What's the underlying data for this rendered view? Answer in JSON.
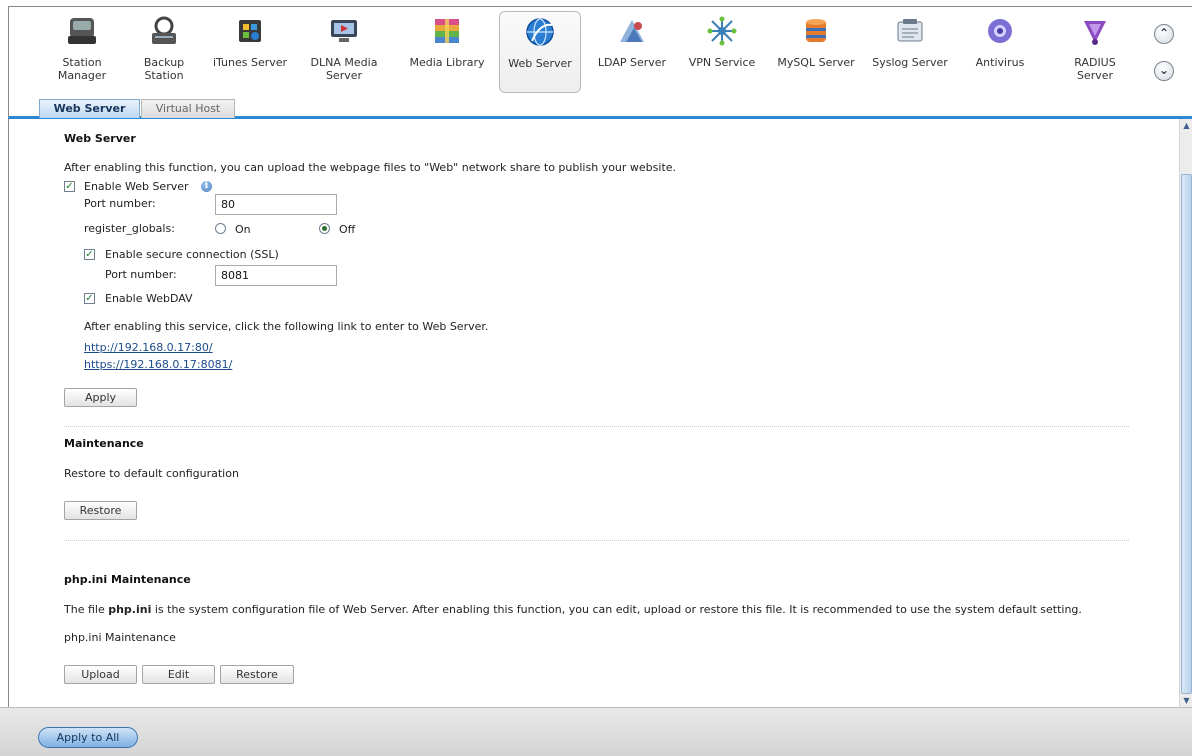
{
  "apps": [
    {
      "id": "station-manager",
      "label": "Station\nManager",
      "icon": "station-manager-icon"
    },
    {
      "id": "backup-station",
      "label": "Backup\nStation",
      "icon": "backup-station-icon"
    },
    {
      "id": "itunes-server",
      "label": "iTunes Server",
      "icon": "itunes-server-icon"
    },
    {
      "id": "dlna-media-server",
      "label": "DLNA Media\nServer",
      "icon": "dlna-media-server-icon"
    },
    {
      "id": "media-library",
      "label": "Media Library",
      "icon": "media-library-icon"
    },
    {
      "id": "web-server",
      "label": "Web Server",
      "icon": "web-server-icon",
      "active": true
    },
    {
      "id": "ldap-server",
      "label": "LDAP Server",
      "icon": "ldap-server-icon"
    },
    {
      "id": "vpn-service",
      "label": "VPN Service",
      "icon": "vpn-service-icon"
    },
    {
      "id": "mysql-server",
      "label": "MySQL Server",
      "icon": "mysql-server-icon"
    },
    {
      "id": "syslog-server",
      "label": "Syslog Server",
      "icon": "syslog-server-icon"
    },
    {
      "id": "antivirus",
      "label": "Antivirus",
      "icon": "antivirus-icon"
    },
    {
      "id": "radius-server",
      "label": "RADIUS\nServer",
      "icon": "radius-server-icon"
    }
  ],
  "nav": {
    "up_icon": "chevron-up-icon",
    "down_icon": "chevron-down-icon"
  },
  "tabs": [
    {
      "label": "Web Server",
      "active": true
    },
    {
      "label": "Virtual Host",
      "active": false
    }
  ],
  "web_server": {
    "title": "Web Server",
    "description": "After enabling this function, you can upload the webpage files to \"Web\" network share to publish your website.",
    "enable_label": "Enable Web Server",
    "enable_checked": true,
    "port_label": "Port number:",
    "port_value": "80",
    "register_globals_label": "register_globals:",
    "on_label": "On",
    "off_label": "Off",
    "register_globals_value": "Off",
    "ssl_label": "Enable secure connection (SSL)",
    "ssl_checked": true,
    "ssl_port_label": "Port number:",
    "ssl_port_value": "8081",
    "webdav_label": "Enable WebDAV",
    "webdav_checked": true,
    "link_note": "After enabling this service, click the following link to enter to Web Server.",
    "http_link": "http://192.168.0.17:80/",
    "https_link": "https://192.168.0.17:8081/",
    "apply_label": "Apply"
  },
  "maintenance": {
    "title": "Maintenance",
    "description": "Restore to default configuration",
    "restore_label": "Restore"
  },
  "php_ini": {
    "title": "php.ini Maintenance",
    "desc_prefix": "The file ",
    "desc_file": "php.ini",
    "desc_suffix": " is the system configuration file of Web Server. After enabling this function, you can edit, upload or restore this file. It is recommended to use the system default setting.",
    "label": "php.ini Maintenance",
    "upload_label": "Upload",
    "edit_label": "Edit",
    "restore_label": "Restore"
  },
  "footer": {
    "apply_all_label": "Apply to All"
  },
  "colors": {
    "accent": "#2f87d3",
    "link": "#1d4d8c",
    "check": "#1a7f2e"
  }
}
